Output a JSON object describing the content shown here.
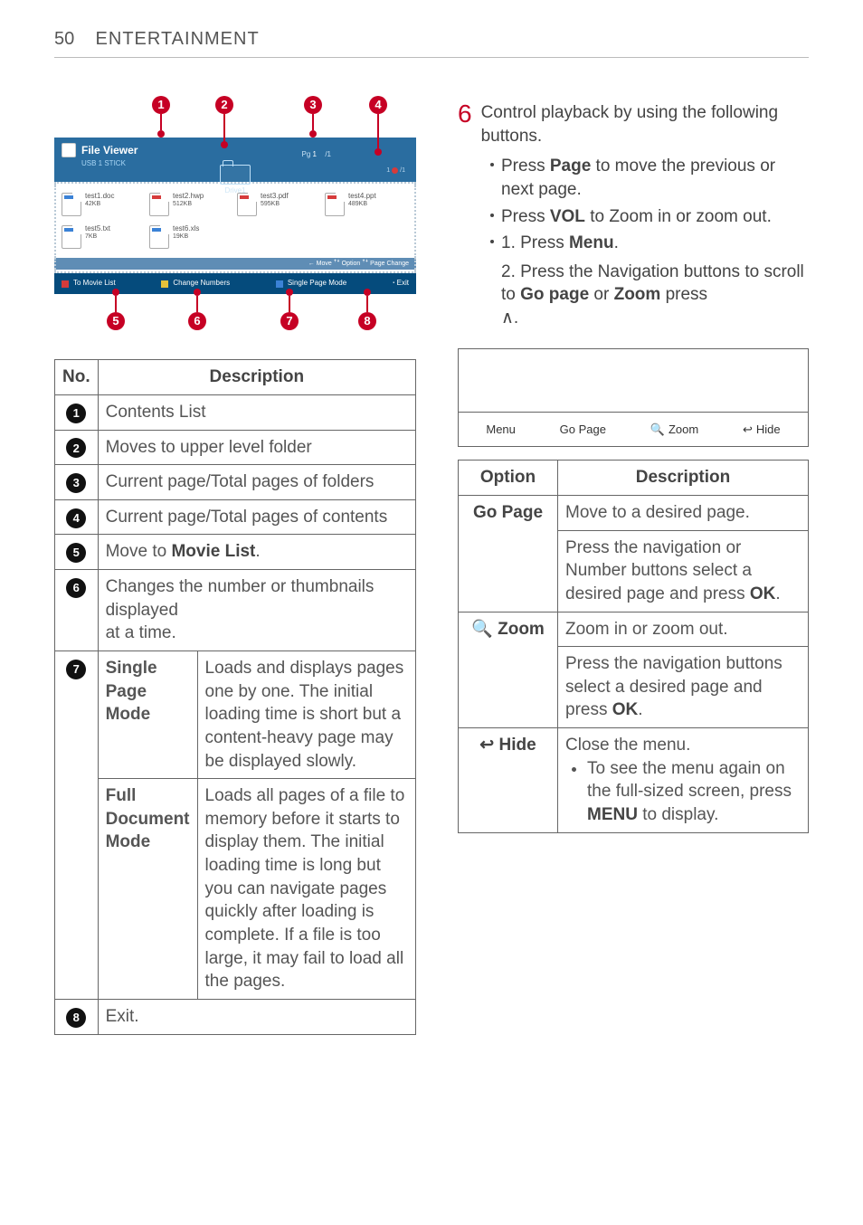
{
  "page": {
    "number": "50",
    "section": "ENTERTAINMENT"
  },
  "fileviewer": {
    "title": "File Viewer",
    "subtitle": "USB 1 STICK",
    "drive_label": "Drive1",
    "pg_left": "Pg",
    "pg_right": "/1",
    "files": [
      {
        "name": "test1.doc",
        "size": "42KB",
        "color": "#3b82d6"
      },
      {
        "name": "test2.hwp",
        "size": "512KB",
        "color": "#d63b3b"
      },
      {
        "name": "test3.pdf",
        "size": "595KB",
        "color": "#d63b3b"
      },
      {
        "name": "test4.ppt",
        "size": "489KB",
        "color": "#d63b3b"
      },
      {
        "name": "test5.txt",
        "size": "7KB",
        "color": "#3b82d6"
      },
      {
        "name": "test6.xls",
        "size": "19KB",
        "color": "#3b82d6"
      }
    ],
    "pager": "← Move      ꜛꜜ Option     ꜛꜜ Page Change",
    "footer": {
      "left": "To Movie List",
      "mid": "Change Numbers",
      "right": "Single Page Mode",
      "exit": "ꞏ Exit"
    }
  },
  "legend": {
    "head_no": "No.",
    "head_desc": "Description",
    "rows": [
      {
        "n": "1",
        "txt": "Contents List"
      },
      {
        "n": "2",
        "txt": "Moves to upper level folder"
      },
      {
        "n": "3",
        "txt": "Current page/Total pages of folders"
      },
      {
        "n": "4",
        "txt": "Current page/Total pages of contents"
      },
      {
        "n": "5",
        "txt_prefix": "Move to ",
        "txt_bold": "Movie List",
        "txt_suffix": "."
      },
      {
        "n": "6",
        "txt": "Changes the number or thumbnails displayed\nat a time."
      }
    ],
    "row7": {
      "n": "7",
      "mode1_name": "Single Page Mode",
      "mode1_desc": "Loads and displays pages one by one. The initial loading time is short but a content-heavy page may be displayed slowly.",
      "mode2_name": "Full Document Mode",
      "mode2_desc": "Loads all pages of a file to memory before it starts to display them. The initial loading time is long but you can navigate pages quickly after loading is complete. If a file is too large, it may fail to load all the pages."
    },
    "row8": {
      "n": "8",
      "txt": "Exit."
    }
  },
  "right": {
    "step_num": "6",
    "step_text": "Control playback by using the following buttons.",
    "b1_a": "Press ",
    "b1_b": "Page",
    "b1_c": " to move the previous or next page.",
    "b2_a": "Press ",
    "b2_b": "VOL",
    "b2_c": " to Zoom in or zoom out.",
    "b3_1a": "1. Press ",
    "b3_1b": "Menu",
    "b3_1c": ".",
    "b3_2a": "2. Press the Navigation buttons to scroll to ",
    "b3_2b": "Go page",
    "b3_2c": " or ",
    "b3_2d": "Zoom",
    "b3_2e": " press ",
    "b3_2f": "∧",
    "b3_2g": ".",
    "menubar": {
      "items": [
        "Menu",
        "Go Page",
        "Zoom",
        "Hide"
      ],
      "zoom_icon": "🔍",
      "hide_icon": "↩"
    },
    "opt_head_l": "Option",
    "opt_head_r": "Description",
    "opt1_name": "Go Page",
    "opt1_line1": "Move to a desired page.",
    "opt1_line2a": "Press the navigation or Number buttons select a desired page and press ",
    "opt1_line2b": "OK",
    "opt1_line2c": ".",
    "opt2_name": "Zoom",
    "opt2_icon": "🔍",
    "opt2_line1": "Zoom in or zoom out.",
    "opt2_line2a": "Press the navigation buttons select a desired page and press ",
    "opt2_line2b": "OK",
    "opt2_line2c": ".",
    "opt3_icon": "↩",
    "opt3_name": "Hide",
    "opt3_line1": "Close the menu.",
    "opt3_li_a": "To see the menu again on the full-sized screen, press ",
    "opt3_li_b": "MENU",
    "opt3_li_c": " to display."
  }
}
